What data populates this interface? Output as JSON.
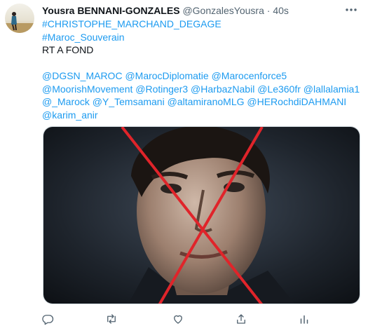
{
  "tweet": {
    "author_name": "Yousra BENNANI-GONZALES",
    "author_handle": "@GonzalesYousra",
    "separator": "·",
    "time": "40s",
    "lines": [
      {
        "text": "#CHRISTOPHE_MARCHAND_DEGAGE",
        "kind": "hashtag"
      },
      {
        "text": "#Maroc_Souverain",
        "kind": "hashtag"
      },
      {
        "text": "RT A FOND",
        "kind": "plain"
      }
    ],
    "mention_lines": [
      "@DGSN_MAROC @MarocDiplomatie @Marocenforce5",
      "@MoorishMovement @Rotinger3 @HarbazNabil @Le360fr @lallalamia1",
      "@_Marock @Y_Temsamani @altamiranoMLG @HERochdiDAHMANI",
      "@karim_anir"
    ],
    "media_description_icon": "portrait-photo-with-red-x"
  },
  "actions": [
    {
      "name": "reply",
      "icon": "reply-icon"
    },
    {
      "name": "retweet",
      "icon": "retweet-icon"
    },
    {
      "name": "like",
      "icon": "like-icon"
    },
    {
      "name": "share",
      "icon": "share-icon"
    },
    {
      "name": "analytics",
      "icon": "analytics-icon"
    }
  ],
  "colors": {
    "link": "#1d9bf0",
    "secondary_text": "#536471",
    "primary_text": "#0f1419",
    "cross": "#e0242a"
  }
}
